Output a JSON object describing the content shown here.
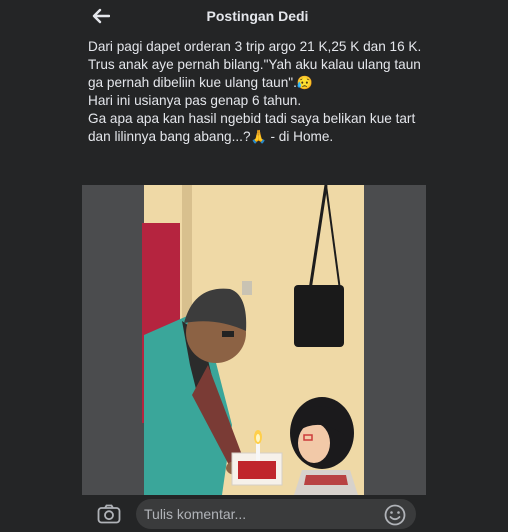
{
  "header": {
    "title": "Postingan Dedi",
    "back_icon": "arrow-left-icon"
  },
  "post": {
    "line1": "Dari pagi dapet orderan 3 trip argo 21 K,25 K dan 16 K.",
    "line2": "Trus anak aye pernah bilang.\"Yah aku kalau ulang taun ga pernah dibeliin kue ulang taun\".",
    "line2_emoji": "😥",
    "line3": "Hari ini usianya pas genap 6 tahun.",
    "line4": "Ga apa apa kan hasil ngebid tadi saya belikan kue tart dan lilinnya bang abang...?",
    "line4_emoji": "🙏",
    "line4_suffix": " - di Home."
  },
  "comment_bar": {
    "placeholder": "Tulis komentar...",
    "camera_icon": "camera-icon",
    "emoji_icon": "smiley-icon"
  }
}
